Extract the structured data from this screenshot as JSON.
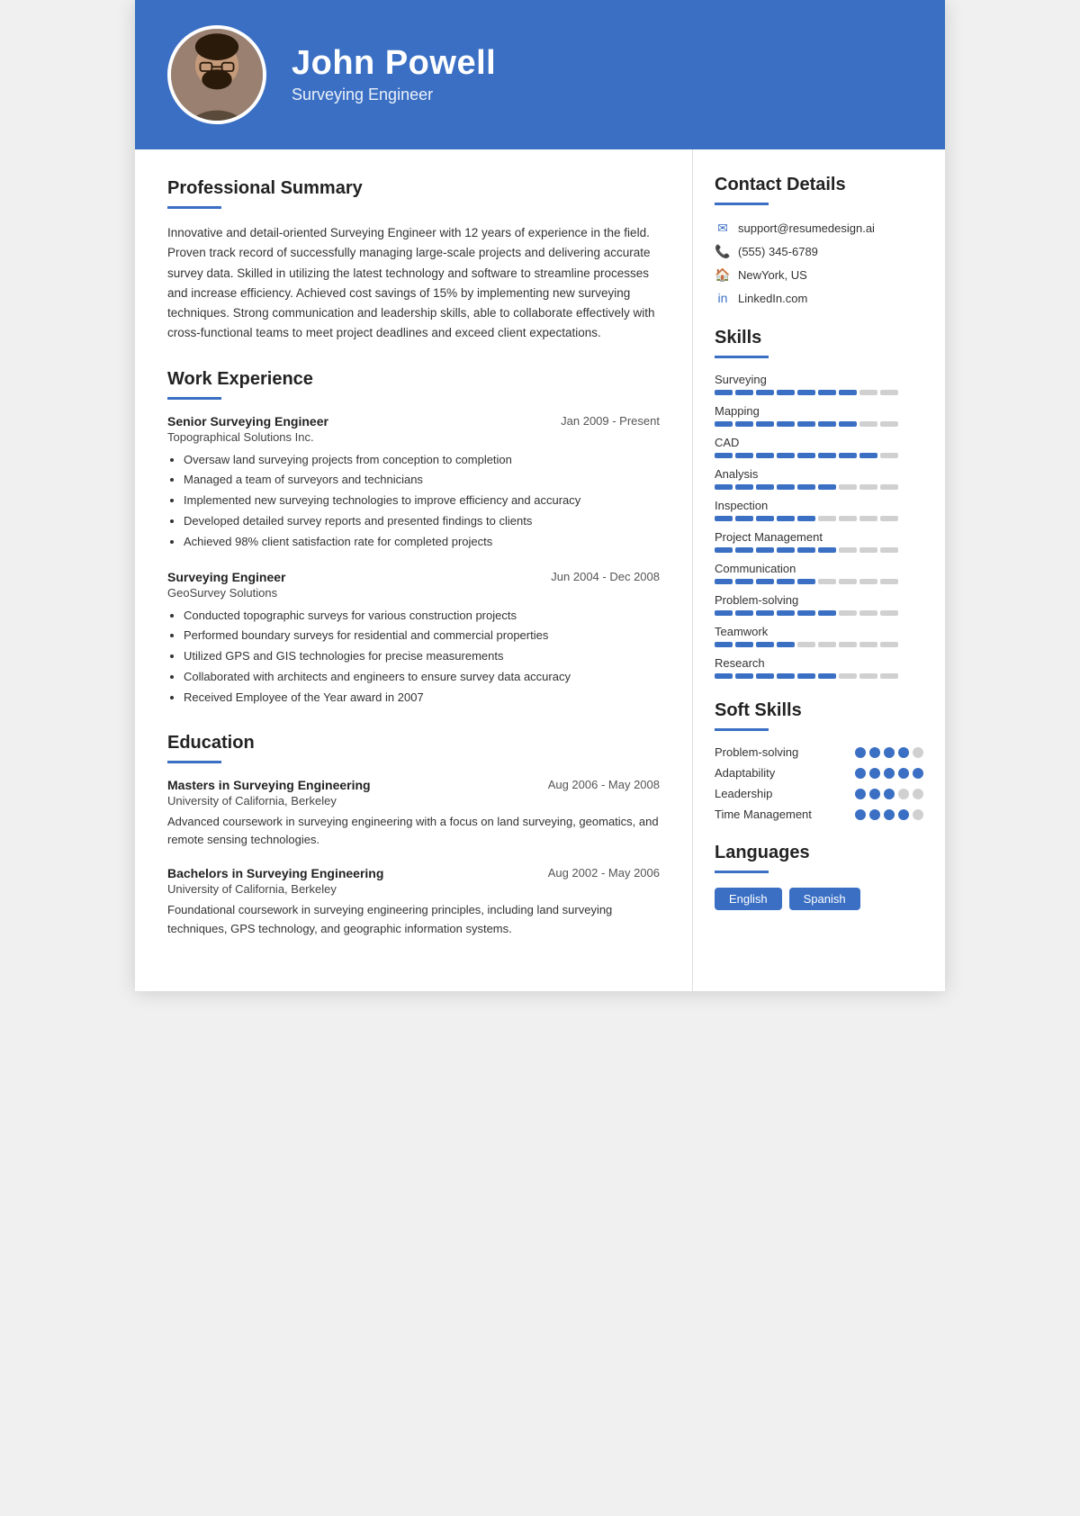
{
  "header": {
    "name": "John Powell",
    "title": "Surveying Engineer"
  },
  "summary": {
    "section_title": "Professional Summary",
    "text": "Innovative and detail-oriented Surveying Engineer with 12 years of experience in the field. Proven track record of successfully managing large-scale projects and delivering accurate survey data. Skilled in utilizing the latest technology and software to streamline processes and increase efficiency. Achieved cost savings of 15% by implementing new surveying techniques. Strong communication and leadership skills, able to collaborate effectively with cross-functional teams to meet project deadlines and exceed client expectations."
  },
  "work": {
    "section_title": "Work Experience",
    "jobs": [
      {
        "title": "Senior Surveying Engineer",
        "company": "Topographical Solutions Inc.",
        "dates": "Jan 2009 - Present",
        "bullets": [
          "Oversaw land surveying projects from conception to completion",
          "Managed a team of surveyors and technicians",
          "Implemented new surveying technologies to improve efficiency and accuracy",
          "Developed detailed survey reports and presented findings to clients",
          "Achieved 98% client satisfaction rate for completed projects"
        ]
      },
      {
        "title": "Surveying Engineer",
        "company": "GeoSurvey Solutions",
        "dates": "Jun 2004 - Dec 2008",
        "bullets": [
          "Conducted topographic surveys for various construction projects",
          "Performed boundary surveys for residential and commercial properties",
          "Utilized GPS and GIS technologies for precise measurements",
          "Collaborated with architects and engineers to ensure survey data accuracy",
          "Received Employee of the Year award in 2007"
        ]
      }
    ]
  },
  "education": {
    "section_title": "Education",
    "items": [
      {
        "degree": "Masters in Surveying Engineering",
        "school": "University of California, Berkeley",
        "dates": "Aug 2006 - May 2008",
        "desc": "Advanced coursework in surveying engineering with a focus on land surveying, geomatics, and remote sensing technologies."
      },
      {
        "degree": "Bachelors in Surveying Engineering",
        "school": "University of California, Berkeley",
        "dates": "Aug 2002 - May 2006",
        "desc": "Foundational coursework in surveying engineering principles, including land surveying techniques, GPS technology, and geographic information systems."
      }
    ]
  },
  "contact": {
    "section_title": "Contact Details",
    "email": "support@resumedesign.ai",
    "phone": "(555) 345-6789",
    "location": "NewYork, US",
    "linkedin": "LinkedIn.com"
  },
  "skills": {
    "section_title": "Skills",
    "items": [
      {
        "name": "Surveying",
        "filled": 7,
        "total": 9
      },
      {
        "name": "Mapping",
        "filled": 7,
        "total": 9
      },
      {
        "name": "CAD",
        "filled": 8,
        "total": 9
      },
      {
        "name": "Analysis",
        "filled": 6,
        "total": 9
      },
      {
        "name": "Inspection",
        "filled": 5,
        "total": 9
      },
      {
        "name": "Project Management",
        "filled": 6,
        "total": 9
      },
      {
        "name": "Communication",
        "filled": 5,
        "total": 9
      },
      {
        "name": "Problem-solving",
        "filled": 6,
        "total": 9
      },
      {
        "name": "Teamwork",
        "filled": 4,
        "total": 9
      },
      {
        "name": "Research",
        "filled": 6,
        "total": 9
      }
    ]
  },
  "soft_skills": {
    "section_title": "Soft Skills",
    "items": [
      {
        "name": "Problem-solving",
        "filled": 4,
        "total": 5
      },
      {
        "name": "Adaptability",
        "filled": 5,
        "total": 5
      },
      {
        "name": "Leadership",
        "filled": 3,
        "total": 5
      },
      {
        "name": "Time Management",
        "filled": 4,
        "total": 5
      }
    ]
  },
  "languages": {
    "section_title": "Languages",
    "items": [
      "English",
      "Spanish"
    ]
  }
}
